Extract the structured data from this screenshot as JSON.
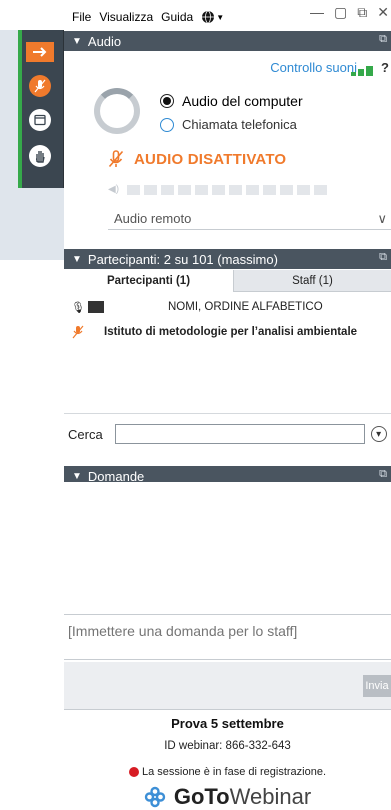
{
  "menu": {
    "file": "File",
    "view": "Visualizza",
    "help": "Guida"
  },
  "audio": {
    "header": "Audio",
    "sound_check": "Controllo suoni",
    "help_mark": "?",
    "option_computer": "Audio del computer",
    "option_phone": "Chiamata telefonica",
    "muted_label": "AUDIO DISATTIVATO",
    "device_select": "Audio remoto",
    "volume_segments": 12
  },
  "participants": {
    "header": "Partecipanti: 2 su 101 (massimo)",
    "tab_participants": "Partecipanti (1)",
    "tab_staff": "Staff (1)",
    "column_names": "NOMI, ORDINE ALFABETICO",
    "rows": [
      {
        "name": "Istituto di metodologie per l’analisi ambientale"
      }
    ],
    "search_label": "Cerca",
    "search_value": ""
  },
  "questions": {
    "header": "Domande",
    "input_placeholder": "[Immettere una domanda per lo staff]",
    "send_label": "Invia"
  },
  "footer": {
    "webinar_title": "Prova 5 settembre",
    "webinar_id": "ID webinar: 866-332-643",
    "recording_text": "La sessione è in fase di registrazione.",
    "logo_bold": "GoTo",
    "logo_regular": "Webinar"
  },
  "colors": {
    "accent_orange": "#f07a2c",
    "header_dark": "#4a5560",
    "link_blue": "#2f8ad3",
    "record_red": "#d71c24",
    "signal_green": "#35a94a"
  },
  "icons": [
    "arrow-right-icon",
    "microphone-icon",
    "window-icon",
    "hand-icon",
    "globe-icon",
    "popout-icon",
    "muted-mic-icon",
    "speaker-icon",
    "chevron-down-icon",
    "webinar-logo-icon"
  ]
}
